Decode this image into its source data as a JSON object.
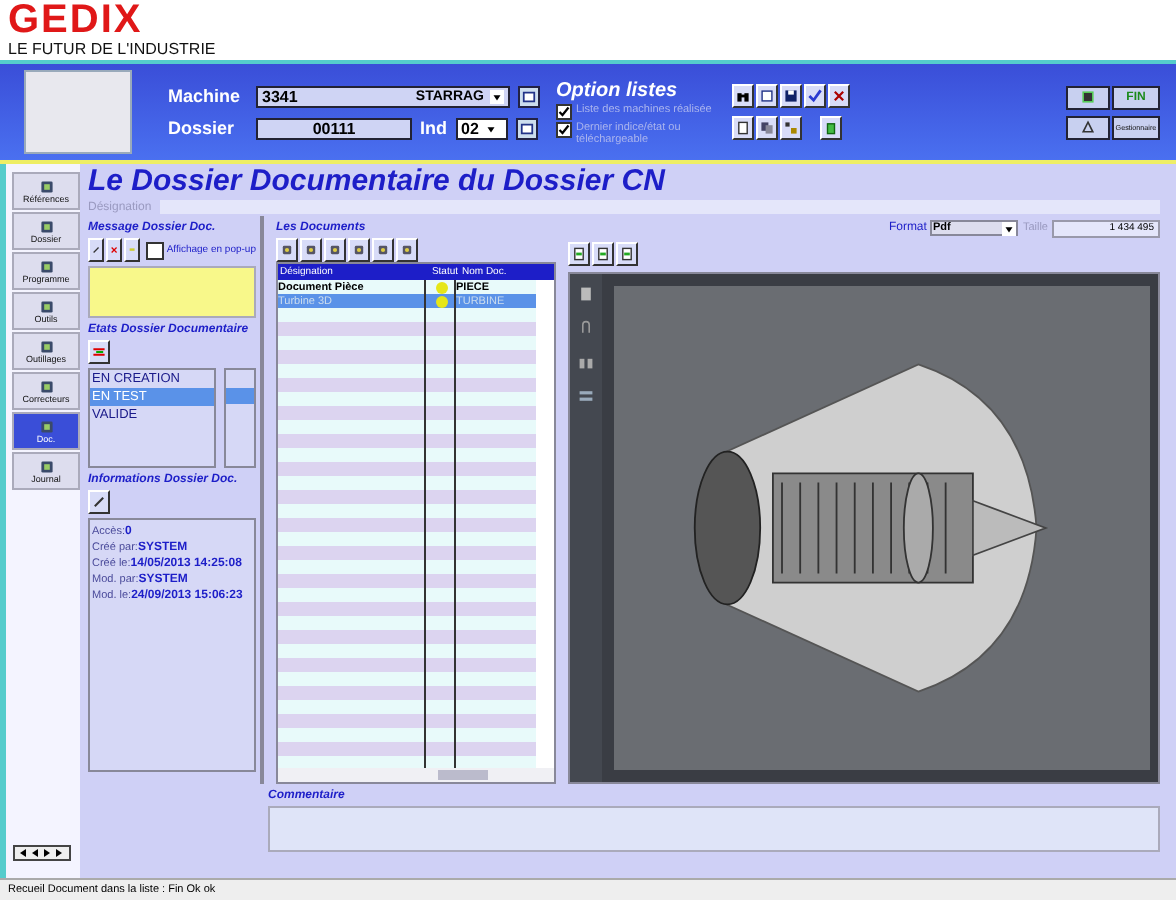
{
  "logo": {
    "name": "GEDIX",
    "tagline": "LE FUTUR DE L'INDUSTRIE"
  },
  "header": {
    "machine_label": "Machine",
    "machine_value": "3341",
    "machine_name": "STARRAG",
    "dossier_label": "Dossier",
    "dossier_value": "00111",
    "ind_label": "Ind",
    "ind_value": "02",
    "options_title": "Option listes",
    "options": [
      {
        "label": "Liste des machines réalisée",
        "checked": true
      },
      {
        "label": "Dernier indice/état ou téléchargeable",
        "checked": true
      }
    ],
    "fin_button": "FIN",
    "manager_button": "Gestionnaire"
  },
  "sidebar": {
    "items": [
      {
        "label": "Références",
        "selected": false
      },
      {
        "label": "Dossier",
        "selected": false
      },
      {
        "label": "Programme",
        "selected": false
      },
      {
        "label": "Outils",
        "selected": false
      },
      {
        "label": "Outillages",
        "selected": false
      },
      {
        "label": "Correcteurs",
        "selected": false
      },
      {
        "label": "Doc.",
        "selected": true
      },
      {
        "label": "Journal",
        "selected": false
      }
    ]
  },
  "page_title": "Le Dossier Documentaire du Dossier CN",
  "designation_label": "Désignation",
  "message_panel": {
    "title": "Message Dossier Doc.",
    "popup_label": "Affichage en pop-up",
    "popup_checked": false
  },
  "states_panel": {
    "title": "Etats Dossier Documentaire",
    "items": [
      {
        "label": "EN CREATION",
        "selected": false
      },
      {
        "label": "EN TEST",
        "selected": true
      },
      {
        "label": "VALIDE",
        "selected": false
      }
    ]
  },
  "info_panel": {
    "title": "Informations Dossier Doc.",
    "rows": [
      {
        "label": "Accès:",
        "value": "0"
      },
      {
        "label": "Créé par:",
        "value": "SYSTEM"
      },
      {
        "label": "Créé le:",
        "value": "14/05/2013 14:25:08"
      },
      {
        "label": "Mod. par:",
        "value": "SYSTEM"
      },
      {
        "label": "Mod. le:",
        "value": "24/09/2013 15:06:23"
      }
    ]
  },
  "documents": {
    "title": "Les Documents",
    "columns": [
      "Désignation",
      "Statut",
      "Nom Doc."
    ],
    "rows": [
      {
        "designation": "Document Pièce",
        "color": "#e6e619",
        "name": "PIECE",
        "selected": false
      },
      {
        "designation": "Turbine 3D",
        "color": "#e6e619",
        "name": "TURBINE",
        "selected": true
      }
    ]
  },
  "viewer": {
    "format_label": "Format",
    "format_value": "Pdf",
    "size_label": "Taille",
    "size_value": "1 434 495"
  },
  "comment": {
    "title": "Commentaire"
  },
  "status_bar": "Recueil Document dans la liste : Fin Ok ok"
}
